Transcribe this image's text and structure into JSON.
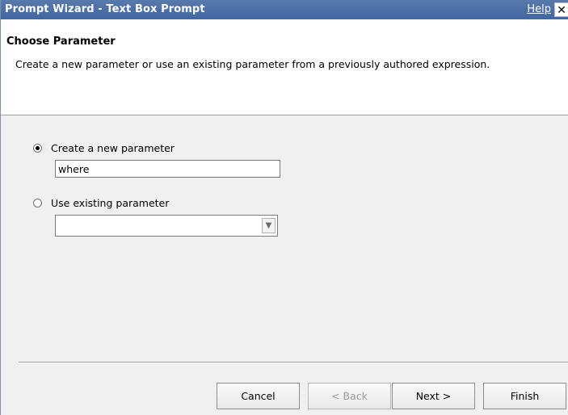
{
  "window": {
    "title": "Prompt Wizard - Text Box Prompt",
    "help_label": "Help",
    "close_label": "✕"
  },
  "header": {
    "title": "Choose Parameter",
    "description": "Create a new parameter or use an existing parameter from a previously authored expression."
  },
  "options": {
    "create_new": {
      "label": "Create a new parameter",
      "selected": true,
      "value": "where"
    },
    "use_existing": {
      "label": "Use existing parameter",
      "selected": false,
      "value": ""
    }
  },
  "buttons": {
    "cancel": "Cancel",
    "back": "< Back",
    "next": "Next >",
    "finish": "Finish"
  }
}
